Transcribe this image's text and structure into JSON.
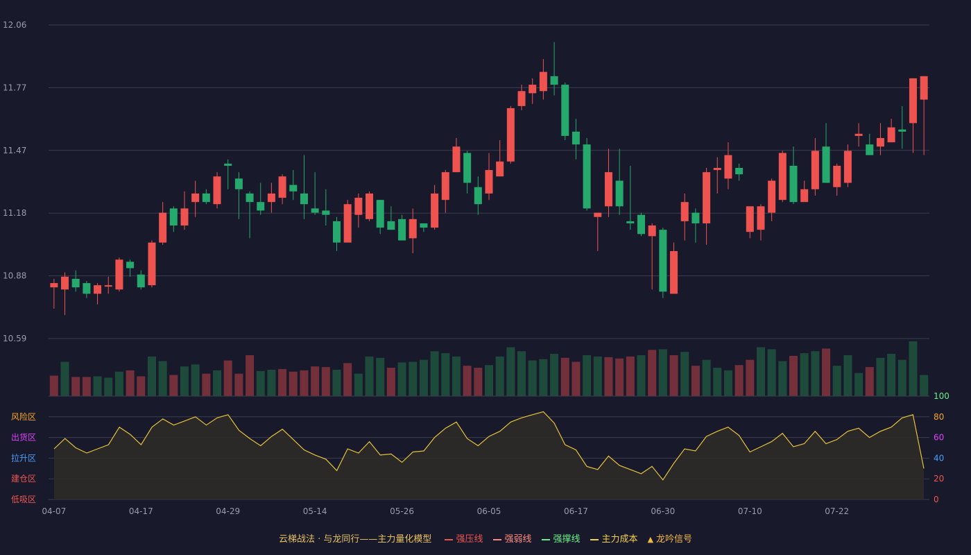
{
  "chart_data": {
    "type": "candlestick",
    "dates": [
      "04-07",
      "04-08",
      "04-09",
      "04-10",
      "04-11",
      "04-14",
      "04-15",
      "04-16",
      "04-17",
      "04-18",
      "04-21",
      "04-22",
      "04-23",
      "04-24",
      "04-25",
      "04-28",
      "04-29",
      "04-30",
      "05-06",
      "05-07",
      "05-08",
      "05-09",
      "05-12",
      "05-13",
      "05-14",
      "05-15",
      "05-16",
      "05-19",
      "05-20",
      "05-21",
      "05-22",
      "05-23",
      "05-26",
      "05-27",
      "05-28",
      "05-29",
      "05-30",
      "06-03",
      "06-04",
      "06-05",
      "06-06",
      "06-09",
      "06-10",
      "06-11",
      "06-12",
      "06-13",
      "06-16",
      "06-17",
      "06-18",
      "06-19",
      "06-20",
      "06-23",
      "06-24",
      "06-25",
      "06-26",
      "06-27",
      "06-30",
      "07-01",
      "07-02",
      "07-03",
      "07-04",
      "07-07",
      "07-08",
      "07-09",
      "07-10",
      "07-11",
      "07-14",
      "07-15",
      "07-16",
      "07-17",
      "07-18",
      "07-21",
      "07-22",
      "07-23",
      "07-24",
      "07-25",
      "07-28",
      "07-29",
      "07-30",
      "07-31",
      "08-01"
    ],
    "x_tick_labels": [
      "04-07",
      "04-17",
      "04-29",
      "05-14",
      "05-26",
      "06-05",
      "06-17",
      "06-30",
      "07-10",
      "07-22"
    ],
    "x_tick_index": [
      0,
      8,
      16,
      24,
      32,
      40,
      48,
      56,
      64,
      72
    ],
    "price": {
      "ylim": [
        10.59,
        12.06
      ],
      "y_ticks": [
        "12.06",
        "11.77",
        "11.47",
        "11.18",
        "10.88",
        "10.59"
      ],
      "candles": [
        [
          10.83,
          10.85,
          10.79,
          10.87,
          10.73
        ],
        [
          10.82,
          10.88,
          10.81,
          10.9,
          10.7
        ],
        [
          10.87,
          10.83,
          10.82,
          10.91,
          10.81
        ],
        [
          10.85,
          10.8,
          10.79,
          10.86,
          10.78
        ],
        [
          10.8,
          10.84,
          10.79,
          10.85,
          10.75
        ],
        [
          10.84,
          10.84,
          10.83,
          10.88,
          10.8
        ],
        [
          10.82,
          10.96,
          10.82,
          10.97,
          10.81
        ],
        [
          10.95,
          10.92,
          10.88,
          10.96,
          10.88
        ],
        [
          10.89,
          10.83,
          10.82,
          10.91,
          10.82
        ],
        [
          10.84,
          11.04,
          10.84,
          11.05,
          10.83
        ],
        [
          11.04,
          11.18,
          11.03,
          11.23,
          11.03
        ],
        [
          11.2,
          11.12,
          11.1,
          11.21,
          11.09
        ],
        [
          11.12,
          11.2,
          11.11,
          11.28,
          11.1
        ],
        [
          11.23,
          11.27,
          11.23,
          11.33,
          11.16
        ],
        [
          11.27,
          11.23,
          11.21,
          11.29,
          11.22
        ],
        [
          11.22,
          11.35,
          11.21,
          11.37,
          11.2
        ],
        [
          11.41,
          11.4,
          11.39,
          11.43,
          11.29
        ],
        [
          11.34,
          11.29,
          11.28,
          11.37,
          11.15
        ],
        [
          11.27,
          11.23,
          11.2,
          11.28,
          11.06
        ],
        [
          11.23,
          11.19,
          11.18,
          11.32,
          11.17
        ],
        [
          11.23,
          11.27,
          11.23,
          11.32,
          11.18
        ],
        [
          11.25,
          11.35,
          11.24,
          11.36,
          11.22
        ],
        [
          11.31,
          11.28,
          11.27,
          11.38,
          11.24
        ],
        [
          11.27,
          11.22,
          11.22,
          11.45,
          11.15
        ],
        [
          11.2,
          11.18,
          11.18,
          11.37,
          11.17
        ],
        [
          11.19,
          11.17,
          11.16,
          11.29,
          11.12
        ],
        [
          11.14,
          11.04,
          11.03,
          11.16,
          11.0
        ],
        [
          11.04,
          11.22,
          11.04,
          11.24,
          11.04
        ],
        [
          11.17,
          11.25,
          11.16,
          11.27,
          11.11
        ],
        [
          11.15,
          11.27,
          11.15,
          11.28,
          11.14
        ],
        [
          11.24,
          11.11,
          11.11,
          11.24,
          11.08
        ],
        [
          11.14,
          11.1,
          11.1,
          11.21,
          11.1
        ],
        [
          11.15,
          11.05,
          11.05,
          11.17,
          11.05
        ],
        [
          11.06,
          11.15,
          11.04,
          11.2,
          10.99
        ],
        [
          11.13,
          11.11,
          11.1,
          11.13,
          11.09
        ],
        [
          11.11,
          11.27,
          11.1,
          11.31,
          11.1
        ],
        [
          11.24,
          11.37,
          11.24,
          11.38,
          11.18
        ],
        [
          11.37,
          11.49,
          11.37,
          11.53,
          11.37
        ],
        [
          11.46,
          11.32,
          11.31,
          11.47,
          11.27
        ],
        [
          11.3,
          11.22,
          11.22,
          11.35,
          11.17
        ],
        [
          11.27,
          11.38,
          11.24,
          11.46,
          11.24
        ],
        [
          11.35,
          11.42,
          11.34,
          11.52,
          11.35
        ],
        [
          11.42,
          11.67,
          11.42,
          11.68,
          11.41
        ],
        [
          11.68,
          11.75,
          11.67,
          11.78,
          11.66
        ],
        [
          11.74,
          11.78,
          11.7,
          11.81,
          11.69
        ],
        [
          11.75,
          11.84,
          11.74,
          11.9,
          11.71
        ],
        [
          11.82,
          11.78,
          11.76,
          11.98,
          11.73
        ],
        [
          11.78,
          11.54,
          11.53,
          11.79,
          11.52
        ],
        [
          11.56,
          11.5,
          11.47,
          11.62,
          11.43
        ],
        [
          11.5,
          11.2,
          11.19,
          11.53,
          11.19
        ],
        [
          11.16,
          11.18,
          11.16,
          11.18,
          11.0
        ],
        [
          11.21,
          11.37,
          11.21,
          11.48,
          11.16
        ],
        [
          11.33,
          11.21,
          11.18,
          11.48,
          11.17
        ],
        [
          11.14,
          11.13,
          11.13,
          11.4,
          11.1
        ],
        [
          11.17,
          11.08,
          11.08,
          11.18,
          11.07
        ],
        [
          11.07,
          11.12,
          11.06,
          11.13,
          10.82
        ],
        [
          11.1,
          10.81,
          10.8,
          11.11,
          10.78
        ],
        [
          10.8,
          11.0,
          10.8,
          11.04,
          10.8
        ],
        [
          11.14,
          11.23,
          11.14,
          11.27,
          11.05
        ],
        [
          11.18,
          11.13,
          11.12,
          11.2,
          11.04
        ],
        [
          11.13,
          11.37,
          11.12,
          11.39,
          11.03
        ],
        [
          11.38,
          11.39,
          11.37,
          11.44,
          11.27
        ],
        [
          11.34,
          11.45,
          11.34,
          11.51,
          11.29
        ],
        [
          11.39,
          11.36,
          11.35,
          11.41,
          11.33
        ],
        [
          11.09,
          11.21,
          11.07,
          11.21,
          11.06
        ],
        [
          11.1,
          11.21,
          11.08,
          11.22,
          11.05
        ],
        [
          11.18,
          11.33,
          11.17,
          11.34,
          11.14
        ],
        [
          11.24,
          11.46,
          11.23,
          11.47,
          11.23
        ],
        [
          11.4,
          11.23,
          11.23,
          11.49,
          11.22
        ],
        [
          11.23,
          11.29,
          11.23,
          11.33,
          11.24
        ],
        [
          11.29,
          11.47,
          11.29,
          11.53,
          11.26
        ],
        [
          11.49,
          11.32,
          11.32,
          11.6,
          11.32
        ],
        [
          11.3,
          11.4,
          11.3,
          11.41,
          11.26
        ],
        [
          11.32,
          11.47,
          11.32,
          11.5,
          11.3
        ],
        [
          11.54,
          11.55,
          11.54,
          11.6,
          11.49
        ],
        [
          11.5,
          11.45,
          11.44,
          11.55,
          11.45
        ],
        [
          11.49,
          11.53,
          11.48,
          11.6,
          11.45
        ],
        [
          11.51,
          11.58,
          11.51,
          11.62,
          11.53
        ],
        [
          11.57,
          11.56,
          11.55,
          11.68,
          11.48
        ],
        [
          11.6,
          11.81,
          11.59,
          11.81,
          11.46
        ],
        [
          11.71,
          11.82,
          11.7,
          11.82,
          11.45
        ]
      ]
    },
    "volume": {
      "values": [
        31,
        52,
        29,
        29,
        30,
        28,
        37,
        39,
        30,
        60,
        53,
        32,
        45,
        48,
        34,
        39,
        54,
        34,
        62,
        38,
        40,
        41,
        37,
        39,
        45,
        44,
        40,
        50,
        34,
        60,
        58,
        43,
        51,
        52,
        55,
        68,
        65,
        60,
        46,
        43,
        47,
        60,
        74,
        68,
        54,
        56,
        64,
        58,
        52,
        62,
        60,
        59,
        57,
        60,
        62,
        70,
        71,
        62,
        67,
        46,
        55,
        43,
        39,
        47,
        55,
        74,
        71,
        53,
        61,
        65,
        68,
        72,
        46,
        62,
        35,
        44,
        58,
        64,
        55,
        83,
        32
      ],
      "colors": [
        "down",
        "up",
        "down",
        "down",
        "up",
        "up",
        "up",
        "down",
        "down",
        "up",
        "up",
        "down",
        "up",
        "up",
        "down",
        "up",
        "down",
        "down",
        "down",
        "up",
        "up",
        "down",
        "down",
        "down",
        "down",
        "down",
        "up",
        "down",
        "up",
        "up",
        "up",
        "down",
        "up",
        "up",
        "up",
        "up",
        "up",
        "up",
        "down",
        "down",
        "up",
        "up",
        "up",
        "up",
        "up",
        "up",
        "up",
        "down",
        "down",
        "up",
        "up",
        "down",
        "down",
        "down",
        "up",
        "down",
        "up",
        "down",
        "up",
        "down",
        "up",
        "up",
        "up",
        "down",
        "down",
        "up",
        "up",
        "up",
        "down",
        "up",
        "up",
        "down",
        "up",
        "up",
        "up",
        "down",
        "up",
        "up",
        "up",
        "up",
        "up"
      ]
    },
    "oscillator": {
      "ylim": [
        0,
        100
      ],
      "y_ticks": [
        "100",
        "80",
        "60",
        "40",
        "20",
        "0"
      ],
      "zones": [
        "风险区",
        "出货区",
        "拉升区",
        "建仓区",
        "低吸区"
      ],
      "values": [
        49,
        59,
        50,
        45,
        49,
        53,
        70,
        63,
        53,
        70,
        78,
        72,
        76,
        80,
        72,
        79,
        82,
        67,
        59,
        52,
        61,
        68,
        58,
        48,
        43,
        39,
        28,
        49,
        45,
        56,
        43,
        44,
        36,
        46,
        47,
        60,
        69,
        75,
        59,
        52,
        61,
        66,
        75,
        79,
        82,
        85,
        74,
        53,
        48,
        32,
        29,
        42,
        33,
        29,
        25,
        32,
        19,
        35,
        49,
        47,
        61,
        66,
        70,
        62,
        46,
        51,
        56,
        64,
        51,
        54,
        66,
        54,
        58,
        66,
        69,
        60,
        66,
        70,
        79,
        82,
        30
      ]
    },
    "legend": [
      {
        "label": "强压线",
        "color": "#ef5350",
        "style": "solid"
      },
      {
        "label": "强弱线",
        "color": "#ff8a80",
        "style": "dashed"
      },
      {
        "label": "强撑线",
        "color": "#69f08a",
        "style": "solid"
      },
      {
        "label": "主力成本",
        "color": "#f5d04a",
        "style": "dashed"
      },
      {
        "label": "龙吟信号",
        "color": "#f5b942",
        "style": "triangle"
      }
    ],
    "title": "云梯战法 · 与龙同行——主力量化模型",
    "grid": true
  },
  "colors": {
    "up": "#ef5350",
    "down": "#26a96c",
    "vol_up": "#74303a",
    "vol_down": "#1e4a3b",
    "osc_line": "#e6c23a",
    "osc_fill": "#2e2a28",
    "zone_risk": "#f5a623",
    "zone_sell": "#e040fb",
    "zone_rise": "#4a9df8",
    "zone_build": "#ef5350",
    "zone_low": "#ef5350"
  }
}
